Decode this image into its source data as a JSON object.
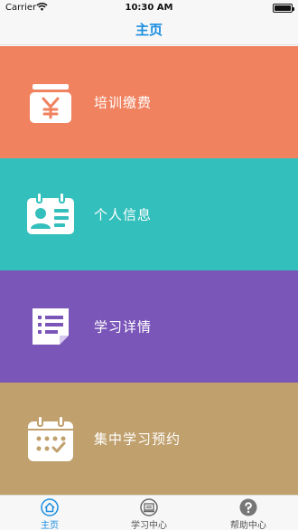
{
  "status_bar": {
    "carrier": "Carrier",
    "time": "10:30 AM"
  },
  "nav": {
    "title": "主页"
  },
  "tiles": [
    {
      "label": "培训缴费",
      "icon": "payment-icon",
      "color": "#f0825f"
    },
    {
      "label": "个人信息",
      "icon": "id-card-icon",
      "color": "#33bfbc"
    },
    {
      "label": "学习详情",
      "icon": "details-list-icon",
      "color": "#7b56b9"
    },
    {
      "label": "集中学习预约",
      "icon": "calendar-icon",
      "color": "#c0a06c"
    }
  ],
  "tabbar": {
    "tabs": [
      {
        "label": "主页",
        "icon": "home-icon",
        "active": true
      },
      {
        "label": "学习中心",
        "icon": "study-center-icon",
        "active": false
      },
      {
        "label": "帮助中心",
        "icon": "help-icon",
        "active": false
      }
    ],
    "active_color": "#1a8ee0"
  }
}
